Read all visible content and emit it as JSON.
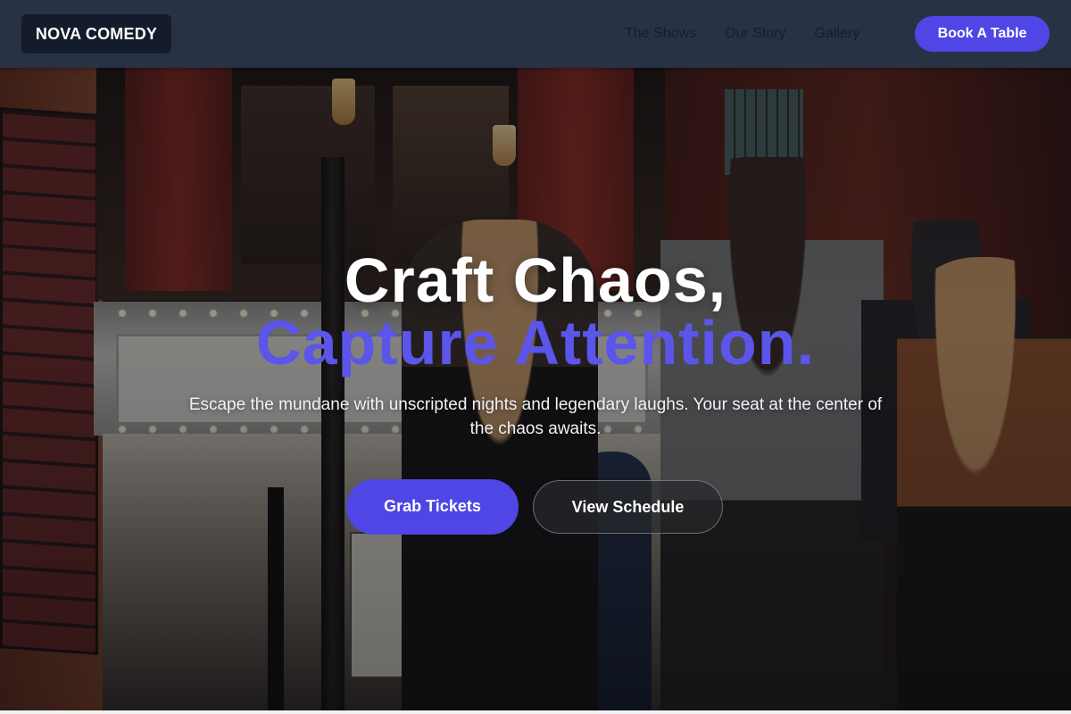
{
  "nav": {
    "logo": "NOVA COMEDY",
    "links": [
      "The Shows",
      "Our Story",
      "Gallery"
    ],
    "cta": "Book A Table"
  },
  "hero": {
    "headline_line1": "Craft Chaos,",
    "headline_line2": "Capture Attention.",
    "subtitle": "Escape the mundane with unscripted nights and legendary laughs. Your seat at the center of the chaos awaits.",
    "primary_button": "Grab Tickets",
    "secondary_button": "View Schedule"
  },
  "colors": {
    "accent": "#4f46e5",
    "headline_accent": "#5b55ea",
    "nav_background": "#283244",
    "logo_background": "#141b2b"
  }
}
